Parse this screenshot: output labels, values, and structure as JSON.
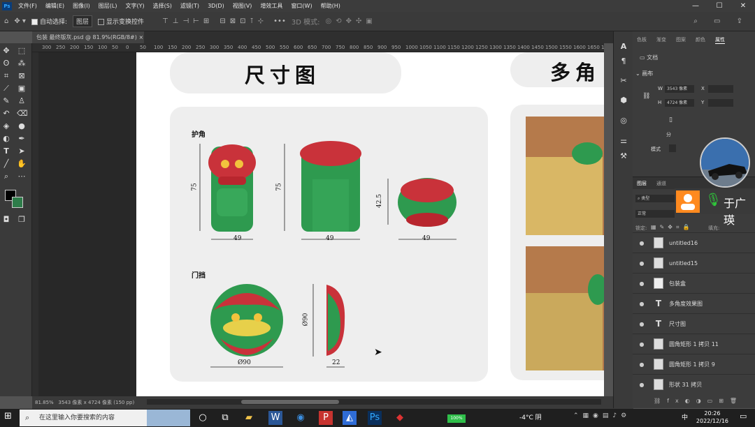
{
  "menubar": {
    "logo": "Ps",
    "items": [
      "文件(F)",
      "编辑(E)",
      "图像(I)",
      "图层(L)",
      "文字(Y)",
      "选择(S)",
      "滤镜(T)",
      "3D(D)",
      "视图(V)",
      "增效工具",
      "窗口(W)",
      "帮助(H)"
    ]
  },
  "options": {
    "auto_select_label": "自动选择:",
    "auto_select_value": "图层",
    "show_transform_label": "显示变换控件",
    "mode_3d": "3D 模式:"
  },
  "tab": {
    "title": "包装 最终版灰.psd @ 81.9%(RGB/8#)"
  },
  "ruler": {
    "ticks": [
      "300",
      "250",
      "200",
      "150",
      "100",
      "50",
      "0",
      "50",
      "100",
      "150",
      "200",
      "250",
      "300",
      "350",
      "400",
      "450",
      "500",
      "550",
      "600",
      "650",
      "700",
      "750",
      "800",
      "850",
      "900",
      "950",
      "1000",
      "1050",
      "1100",
      "1150",
      "1200",
      "1250",
      "1300",
      "1350",
      "1400",
      "1450",
      "1500",
      "1550",
      "1600",
      "1650",
      "1700",
      "1750",
      "1800",
      "1850"
    ]
  },
  "artboard": {
    "title_left": "尺寸图",
    "title_right": "多角",
    "section1_label": "护角",
    "section2_label": "门挡",
    "dims": {
      "h1": "75",
      "w1": "49",
      "h2": "75",
      "w2": "49",
      "h3": "42.5",
      "w3": "49",
      "d1": "Ø90",
      "d2": "Ø90",
      "w4": "22"
    }
  },
  "status": {
    "zoom": "81.85%",
    "size": "3543 像素 x 4724 像素 (150 pp)"
  },
  "properties": {
    "tabs": [
      "色板",
      "渐变",
      "图案",
      "颜色",
      "属性"
    ],
    "doc_label": "文档",
    "canvas_label": "画布",
    "w_label": "W",
    "w_value": "3543 像素",
    "h_label": "H",
    "h_value": "4724 像素",
    "x_label": "X",
    "y_label": "Y",
    "res_label": "分",
    "mode_label": "模式"
  },
  "layers_panel": {
    "tabs": [
      "图层",
      "通道"
    ],
    "filter_label": "类型",
    "normal_label": "正常",
    "lock_label": "锁定:",
    "fill_label": "填充:",
    "layers": [
      {
        "name": "untitled16",
        "kind": "pixel"
      },
      {
        "name": "untitled15",
        "kind": "pixel"
      },
      {
        "name": "包装盒",
        "kind": "smart"
      },
      {
        "name": "多角度效果图",
        "kind": "text"
      },
      {
        "name": "尺寸图",
        "kind": "text"
      },
      {
        "name": "圆角矩形 1 拷贝 11",
        "kind": "smart"
      },
      {
        "name": "圆角矩形 1 拷贝 9",
        "kind": "smart"
      },
      {
        "name": "形状 31 拷贝",
        "kind": "smart"
      }
    ]
  },
  "voice": {
    "name": "于广瑛"
  },
  "taskbar": {
    "search_placeholder": "在这里输入你要搜索的内容",
    "battery": "100%",
    "weather": "-4°C 阴",
    "ime": "中",
    "time": "20:26",
    "date": "2022/12/16"
  }
}
